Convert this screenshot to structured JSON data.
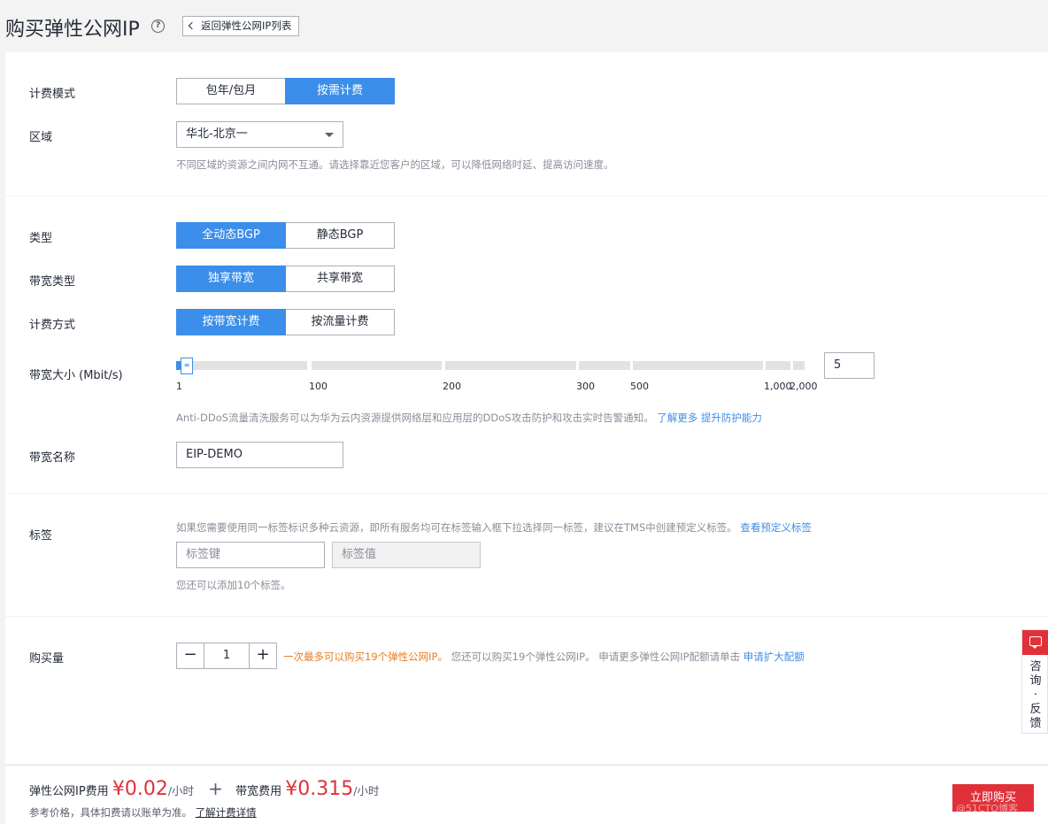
{
  "header": {
    "title": "购买弹性公网IP",
    "help_icon": "question-circle-icon",
    "back_label": "返回弹性公网IP列表"
  },
  "billing": {
    "label": "计费模式",
    "options": [
      "包年/包月",
      "按需计费"
    ],
    "selected": "按需计费"
  },
  "region": {
    "label": "区域",
    "value": "华北-北京一",
    "hint": "不同区域的资源之间内网不互通。请选择靠近您客户的区域，可以降低网络时延、提高访问速度。"
  },
  "type": {
    "label": "类型",
    "options": [
      "全动态BGP",
      "静态BGP"
    ],
    "selected": "全动态BGP"
  },
  "bandwidth_type": {
    "label": "带宽类型",
    "options": [
      "独享带宽",
      "共享带宽"
    ],
    "selected": "独享带宽"
  },
  "charge_method": {
    "label": "计费方式",
    "options": [
      "按带宽计费",
      "按流量计费"
    ],
    "selected": "按带宽计费"
  },
  "bandwidth_size": {
    "label": "带宽大小 (Mbit/s)",
    "value": "5",
    "ticks": [
      "1",
      "100",
      "200",
      "300",
      "500",
      "1,000",
      "2,000"
    ],
    "handle_glyph": "≡",
    "ddos_hint": "Anti-DDoS流量清洗服务可以为华为云内资源提供网络层和应用层的DDoS攻击防护和攻击实时告警通知。",
    "ddos_link": "了解更多 提升防护能力"
  },
  "bandwidth_name": {
    "label": "带宽名称",
    "value": "EIP-DEMO"
  },
  "tags": {
    "label": "标签",
    "hint": "如果您需要使用同一标签标识多种云资源，即所有服务均可在标签输入框下拉选择同一标签，建议在TMS中创建预定义标签。",
    "hint_link": "查看预定义标签",
    "key_placeholder": "标签键",
    "value_placeholder": "标签值",
    "remaining": "您还可以添加10个标签。"
  },
  "quantity": {
    "label": "购买量",
    "minus": "−",
    "plus": "+",
    "value": "1",
    "limit_warn": "一次最多可以购买19个弹性公网IP。",
    "limit_info": "您还可以购买19个弹性公网IP。 申请更多弹性公网IP配额请单击",
    "limit_link": "申请扩大配额"
  },
  "feedback": {
    "icon": "chat-bubble-icon",
    "chars": [
      "咨",
      "询",
      "·",
      "反",
      "馈"
    ]
  },
  "footer": {
    "eip_fee_label": "弹性公网IP费用",
    "eip_price": "¥0.02",
    "eip_unit": "/小时",
    "plus": "+",
    "bw_fee_label": "带宽费用",
    "bw_price": "¥0.315",
    "bw_unit": "/小时",
    "ref_text": "参考价格，具体扣费请以账单为准。",
    "ref_link": "了解计费详情",
    "buy_label": "立即购买",
    "watermark": "@51CTO博客"
  },
  "colors": {
    "accent": "#3b8ee9",
    "price": "#e0313a",
    "warning": "#e67e22",
    "link": "#3f8ee8"
  }
}
